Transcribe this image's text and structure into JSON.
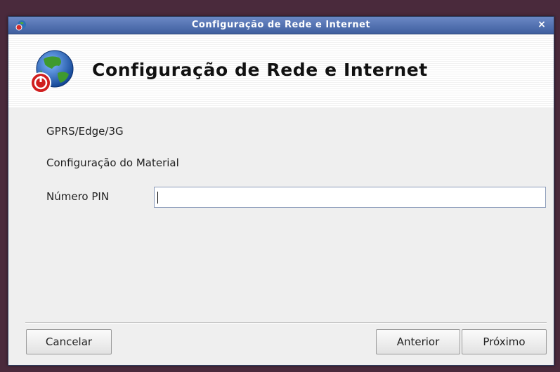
{
  "window": {
    "title": "Configuração de Rede e Internet",
    "close_glyph": "×",
    "app_icon": "network-globe-icon"
  },
  "header": {
    "title": "Configuração de Rede e Internet",
    "icon": "globe-network-icon"
  },
  "content": {
    "connection_type": "GPRS/Edge/3G",
    "section_label": "Configuração do Material",
    "pin_label": "Número PIN",
    "pin_value": ""
  },
  "buttons": {
    "cancel": "Cancelar",
    "back": "Anterior",
    "next": "Próximo"
  },
  "colors": {
    "titlebar": "#4f6fb0",
    "background": "#efefef",
    "header_bg": "#ffffff"
  }
}
